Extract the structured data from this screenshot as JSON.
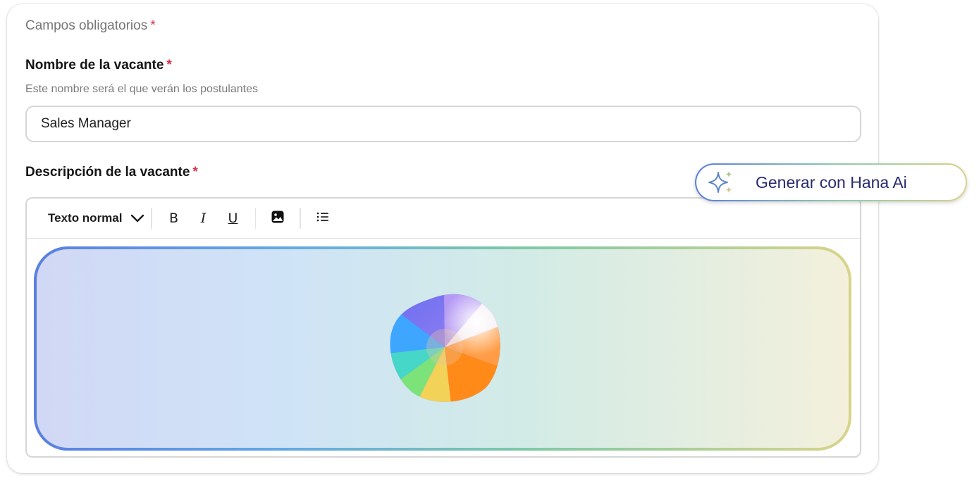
{
  "form": {
    "required_note": "Campos obligatorios",
    "required_mark": "*",
    "name_field": {
      "label": "Nombre de la vacante",
      "helper": "Este nombre será el que verán los postulantes",
      "value": "Sales Manager"
    },
    "description_field": {
      "label": "Descripción de la vacante"
    }
  },
  "editor": {
    "style_select": "Texto normal",
    "toolbar": {
      "bold": "B",
      "italic": "I",
      "underline": "U"
    },
    "icons": [
      "chevron-down-icon",
      "image-icon",
      "bulleted-list-icon",
      "ai-orb-icon"
    ]
  },
  "ai_button": {
    "label": "Generar con Hana Ai",
    "icon": "sparkles-icon"
  },
  "colors": {
    "required": "#d3334a",
    "ai_text": "#2a2a6e",
    "border": "#d6d6d6"
  }
}
